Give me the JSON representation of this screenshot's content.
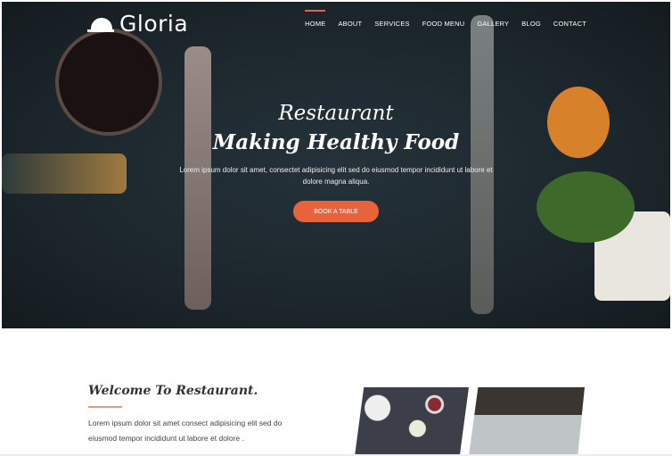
{
  "brand": {
    "name": "Gloria",
    "icon": "cloche-icon"
  },
  "nav": {
    "items": [
      {
        "label": "HOME",
        "active": true
      },
      {
        "label": "ABOUT"
      },
      {
        "label": "SERVICES"
      },
      {
        "label": "FOOD MENU"
      },
      {
        "label": "GALLERY"
      },
      {
        "label": "BLOG"
      },
      {
        "label": "CONTACT"
      }
    ]
  },
  "hero": {
    "subtitle": "Restaurant",
    "title": "Making Healthy Food",
    "text": "Lorem ipsum dolor sit amet, consectet adipisicing elit sed do eiusmod tempor incididunt ut labore et dolore magna aliqua.",
    "button": "BOOK A TABLE"
  },
  "welcome": {
    "title": "Welcome To Restaurant.",
    "text": "Lorem ipsum dolor sit amet consect adipisicing elit sed do eiusmod tempor incididunt ut labore et dolore ."
  },
  "colors": {
    "accent": "#e8623c",
    "hero_bg": "#1f2a30"
  }
}
